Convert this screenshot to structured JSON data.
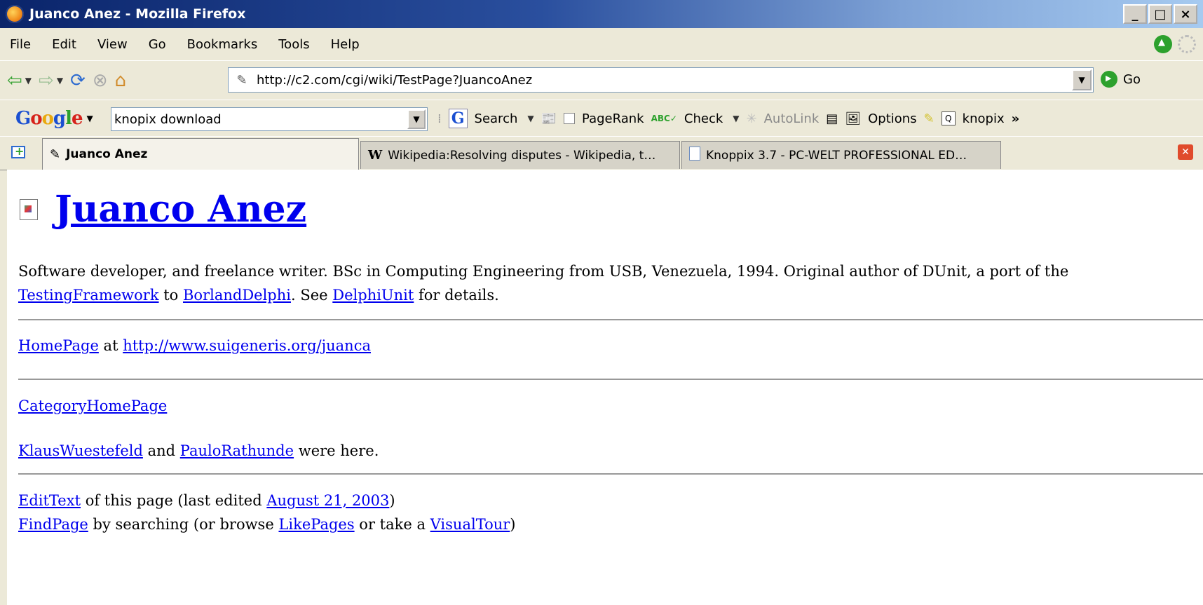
{
  "window": {
    "title": "Juanco Anez - Mozilla Firefox"
  },
  "menu": [
    "File",
    "Edit",
    "View",
    "Go",
    "Bookmarks",
    "Tools",
    "Help"
  ],
  "nav": {
    "url": "http://c2.com/cgi/wiki/TestPage?JuancoAnez",
    "go_label": "Go"
  },
  "google": {
    "search_value": "knopix download",
    "search_label": "Search",
    "pagerank_label": "PageRank",
    "check_label": "Check",
    "autolink_label": "AutoLink",
    "options_label": "Options",
    "highlight_label": "knopix"
  },
  "tabs": [
    {
      "label": "Juanco Anez"
    },
    {
      "label": "Wikipedia:Resolving disputes - Wikipedia, t…"
    },
    {
      "label": "Knoppix 3.7 - PC-WELT PROFESSIONAL ED…"
    }
  ],
  "page": {
    "title": "Juanco Anez",
    "intro": {
      "p1": "Software developer, and freelance writer. BSc in Computing Engineering from USB, Venezuela, 1994. Original author of DUnit, a port of the ",
      "link1": "TestingFramework",
      "p2": " to ",
      "link2": "BorlandDelphi",
      "p3": ". See ",
      "link3": "DelphiUnit",
      "p4": " for details."
    },
    "homepage": {
      "link": "HomePage",
      "at": " at ",
      "url": "http://www.suigeneris.org/juanca"
    },
    "category": "CategoryHomePage",
    "visitors": {
      "v1": "KlausWuestefeld",
      "and": " and ",
      "v2": "PauloRathunde",
      "tail": " were here."
    },
    "footer": {
      "edit_link": "EditText",
      "edit_text": " of this page (last edited ",
      "date_link": "August 21, 2003",
      "close_paren": ")",
      "find_link": "FindPage",
      "find_text": " by searching (or browse ",
      "like_link": "LikePages",
      "or_take": " or take a ",
      "tour_link": "VisualTour",
      "close_paren2": ")"
    }
  }
}
